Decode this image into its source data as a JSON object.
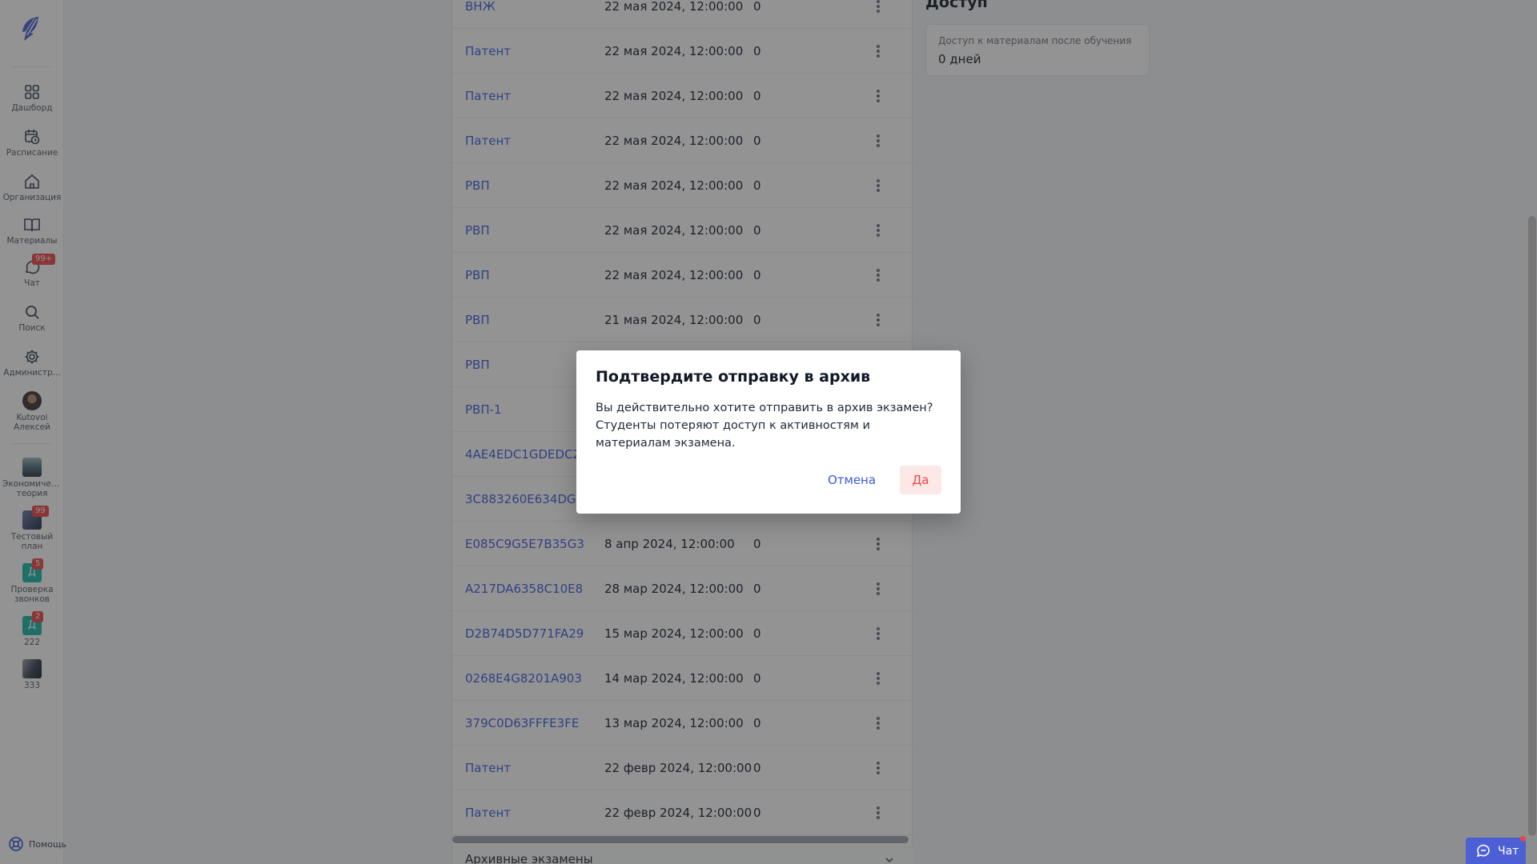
{
  "sidebar": {
    "nav": [
      {
        "label": "Дашборд",
        "icon": "dashboard-icon"
      },
      {
        "label": "Расписание",
        "icon": "calendar-clock-icon"
      },
      {
        "label": "Организация",
        "icon": "home-icon"
      },
      {
        "label": "Материалы",
        "icon": "book-icon"
      },
      {
        "label": "Чат",
        "icon": "chat-icon",
        "badge": "99+"
      },
      {
        "label": "Поиск",
        "icon": "search-icon"
      },
      {
        "label": "Администр...",
        "icon": "gear-icon"
      }
    ],
    "user": {
      "name": "Kutovoi Алексей"
    },
    "courses": [
      {
        "label": "Экономическая теория"
      },
      {
        "label": "Тестовый план",
        "badge": "99"
      },
      {
        "label": "Проверка звонков",
        "letter": "Д",
        "badge": "5"
      },
      {
        "label": "222",
        "letter": "Д",
        "badge": "2"
      },
      {
        "label": "333"
      }
    ],
    "help_label": "Помощь"
  },
  "exams": {
    "rows": [
      {
        "name": "ВНЖ",
        "date": "22 мая 2024, 12:00:00",
        "count": "0"
      },
      {
        "name": "Патент",
        "date": "22 мая 2024, 12:00:00",
        "count": "0"
      },
      {
        "name": "Патент",
        "date": "22 мая 2024, 12:00:00",
        "count": "0"
      },
      {
        "name": "Патент",
        "date": "22 мая 2024, 12:00:00",
        "count": "0"
      },
      {
        "name": "РВП",
        "date": "22 мая 2024, 12:00:00",
        "count": "0"
      },
      {
        "name": "РВП",
        "date": "22 мая 2024, 12:00:00",
        "count": "0"
      },
      {
        "name": "РВП",
        "date": "22 мая 2024, 12:00:00",
        "count": "0"
      },
      {
        "name": "РВП",
        "date": "21 мая 2024, 12:00:00",
        "count": "0"
      },
      {
        "name": "РВП",
        "date": "",
        "count": ""
      },
      {
        "name": "РВП-1",
        "date": "",
        "count": ""
      },
      {
        "name": "4AE4EDC1GDEDC29",
        "date": "",
        "count": ""
      },
      {
        "name": "3C883260E634DGB",
        "date": "",
        "count": ""
      },
      {
        "name": "E085C9G5E7B35G3",
        "date": "8 апр 2024, 12:00:00",
        "count": "0"
      },
      {
        "name": "A217DA6358C10E8",
        "date": "28 мар 2024, 12:00:00",
        "count": "0"
      },
      {
        "name": "D2B74D5D771FA29",
        "date": "15 мар 2024, 12:00:00",
        "count": "0"
      },
      {
        "name": "0268E4G8201A903",
        "date": "14 мар 2024, 12:00:00",
        "count": "0"
      },
      {
        "name": "379C0D63FFFE3FE",
        "date": "13 мар 2024, 12:00:00",
        "count": "0"
      },
      {
        "name": "Патент",
        "date": "22 февр 2024, 12:00:00",
        "count": "0"
      },
      {
        "name": "Патент",
        "date": "22 февр 2024, 12:00:00",
        "count": "0"
      }
    ],
    "archived_label": "Архивные экзамены"
  },
  "access": {
    "title": "Доступ",
    "card_label": "Доступ к материалам после обучения",
    "card_value": "0 дней"
  },
  "modal": {
    "title": "Подтвердите отправку в архив",
    "body": "Вы действительно хотите отправить в архив экзамен? Студенты потеряют доступ к активностям и материалам экзамена.",
    "cancel_label": "Отмена",
    "confirm_label": "Да"
  },
  "chat_widget": {
    "label": "Чат"
  },
  "colors": {
    "link": "#3b5bdb",
    "danger": "#ef4444",
    "accent": "#4c5fd5"
  }
}
